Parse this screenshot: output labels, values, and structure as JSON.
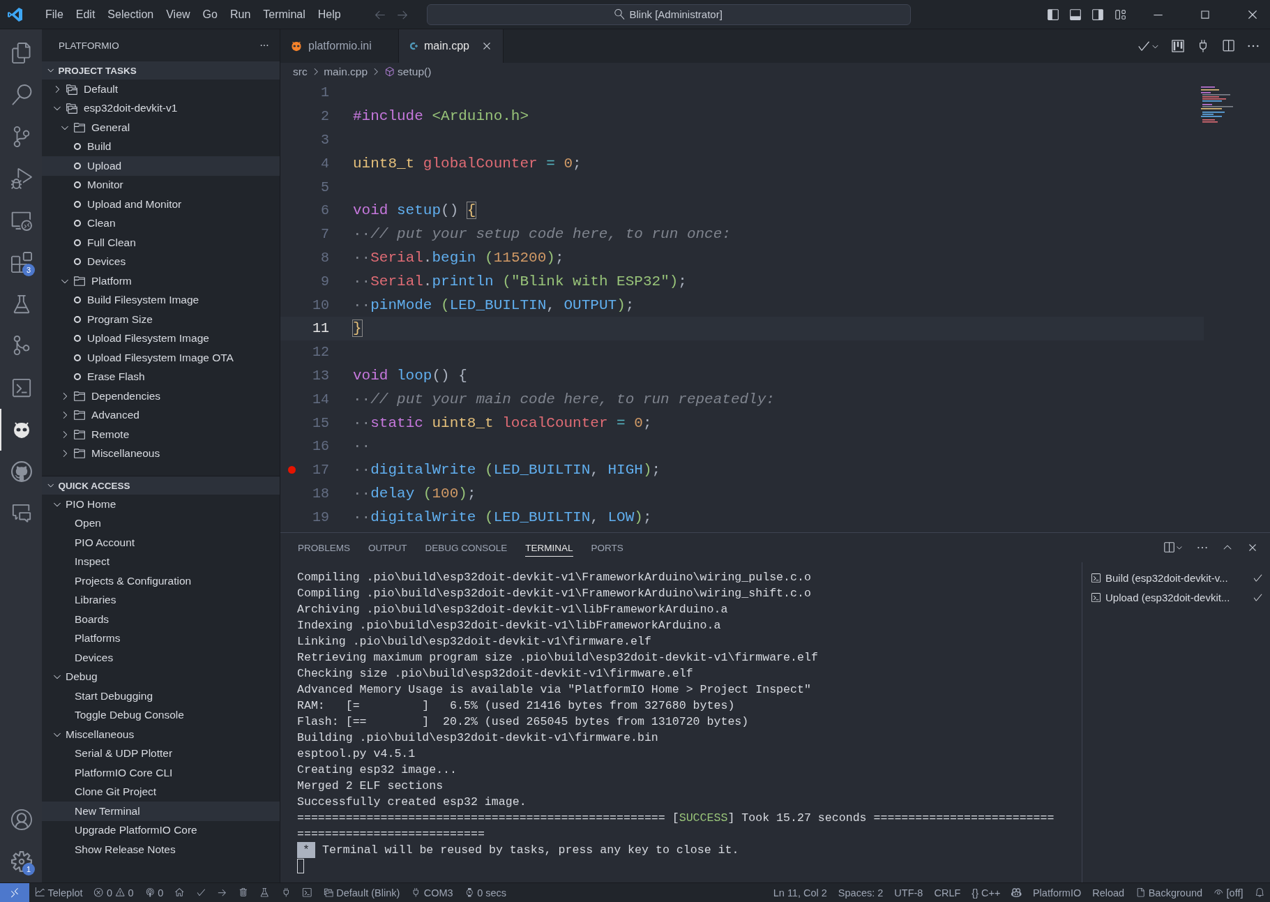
{
  "title_bar": {
    "menu": [
      "File",
      "Edit",
      "Selection",
      "View",
      "Go",
      "Run",
      "Terminal",
      "Help"
    ],
    "search": "Blink [Administrator]"
  },
  "activity_bar": {
    "items": [
      {
        "selected": false
      },
      {
        "selected": false
      },
      {
        "selected": false
      },
      {
        "selected": false
      },
      {
        "selected": false
      },
      {
        "selected": false,
        "badge": "3"
      },
      {
        "selected": false
      },
      {
        "selected": false
      },
      {
        "selected": false
      },
      {
        "selected": true
      },
      {
        "selected": false
      },
      {
        "selected": false
      }
    ],
    "bottom": [
      {
        "selected": false
      },
      {
        "selected": false,
        "badge": "1"
      }
    ]
  },
  "sidebar": {
    "title": "PLATFORMIO",
    "more": "···",
    "sections": [
      {
        "title": "PROJECT TASKS",
        "expanded": true,
        "items": [
          {
            "label": "Default",
            "kind": "env",
            "expanded": false,
            "selected": false
          },
          {
            "label": "esp32doit-devkit-v1",
            "kind": "env",
            "expanded": true,
            "selected": false,
            "children": [
              {
                "label": "General",
                "kind": "folder",
                "expanded": true,
                "selected": false,
                "children": [
                  {
                    "label": "Build",
                    "kind": "task",
                    "selected": false
                  },
                  {
                    "label": "Upload",
                    "kind": "task",
                    "selected": true
                  },
                  {
                    "label": "Monitor",
                    "kind": "task",
                    "selected": false
                  },
                  {
                    "label": "Upload and Monitor",
                    "kind": "task",
                    "selected": false
                  },
                  {
                    "label": "Clean",
                    "kind": "task",
                    "selected": false
                  },
                  {
                    "label": "Full Clean",
                    "kind": "task",
                    "selected": false
                  },
                  {
                    "label": "Devices",
                    "kind": "task",
                    "selected": false
                  }
                ]
              },
              {
                "label": "Platform",
                "kind": "folder",
                "expanded": true,
                "selected": false,
                "children": [
                  {
                    "label": "Build Filesystem Image",
                    "kind": "task",
                    "selected": false
                  },
                  {
                    "label": "Program Size",
                    "kind": "task",
                    "selected": false
                  },
                  {
                    "label": "Upload Filesystem Image",
                    "kind": "task",
                    "selected": false
                  },
                  {
                    "label": "Upload Filesystem Image OTA",
                    "kind": "task",
                    "selected": false
                  },
                  {
                    "label": "Erase Flash",
                    "kind": "task",
                    "selected": false
                  }
                ]
              },
              {
                "label": "Dependencies",
                "kind": "folder",
                "expanded": false,
                "selected": false
              },
              {
                "label": "Advanced",
                "kind": "folder",
                "expanded": false,
                "selected": false
              },
              {
                "label": "Remote",
                "kind": "folder",
                "expanded": false,
                "selected": false
              },
              {
                "label": "Miscellaneous",
                "kind": "folder",
                "expanded": false,
                "selected": false
              }
            ]
          }
        ]
      },
      {
        "title": "QUICK ACCESS",
        "expanded": true,
        "items": [
          {
            "label": "PIO Home",
            "kind": "group",
            "expanded": true,
            "selected": false,
            "children": [
              {
                "label": "Open",
                "kind": "action",
                "selected": false
              },
              {
                "label": "PIO Account",
                "kind": "action",
                "selected": false
              },
              {
                "label": "Inspect",
                "kind": "action",
                "selected": false
              },
              {
                "label": "Projects & Configuration",
                "kind": "action",
                "selected": false
              },
              {
                "label": "Libraries",
                "kind": "action",
                "selected": false
              },
              {
                "label": "Boards",
                "kind": "action",
                "selected": false
              },
              {
                "label": "Platforms",
                "kind": "action",
                "selected": false
              },
              {
                "label": "Devices",
                "kind": "action",
                "selected": false
              }
            ]
          },
          {
            "label": "Debug",
            "kind": "group",
            "expanded": true,
            "selected": false,
            "children": [
              {
                "label": "Start Debugging",
                "kind": "action",
                "selected": false
              },
              {
                "label": "Toggle Debug Console",
                "kind": "action",
                "selected": false
              }
            ]
          },
          {
            "label": "Miscellaneous",
            "kind": "group",
            "expanded": true,
            "selected": false,
            "children": [
              {
                "label": "Serial & UDP Plotter",
                "kind": "action",
                "selected": false
              },
              {
                "label": "PlatformIO Core CLI",
                "kind": "action",
                "selected": false
              },
              {
                "label": "Clone Git Project",
                "kind": "action",
                "selected": false
              },
              {
                "label": "New Terminal",
                "kind": "action",
                "selected": true
              },
              {
                "label": "Upgrade PlatformIO Core",
                "kind": "action",
                "selected": false
              },
              {
                "label": "Show Release Notes",
                "kind": "action",
                "selected": false
              }
            ]
          }
        ]
      }
    ]
  },
  "editor": {
    "tabs": [
      {
        "label": "platformio.ini",
        "kind": "ini",
        "selected": false
      },
      {
        "label": "main.cpp",
        "kind": "cpp",
        "selected": true
      }
    ],
    "breadcrumb": [
      "src",
      "main.cpp",
      "setup()"
    ],
    "lines": [
      {
        "number": "1",
        "breakpoint": false,
        "current": false
      },
      {
        "number": "2",
        "breakpoint": false,
        "current": false,
        "tokens": [
          {
            "text": "#include ",
            "kind": "keyword"
          },
          {
            "text": "<Arduino.h>",
            "kind": "string"
          }
        ]
      },
      {
        "number": "3",
        "breakpoint": false,
        "current": false
      },
      {
        "number": "4",
        "breakpoint": false,
        "current": false,
        "tokens": [
          {
            "text": "uint8_t ",
            "kind": "type"
          },
          {
            "text": "globalCounter",
            "kind": "variable"
          },
          {
            "text": " = ",
            "kind": "operator"
          },
          {
            "text": "0",
            "kind": "number"
          },
          {
            "text": ";",
            "kind": "plain"
          }
        ]
      },
      {
        "number": "5",
        "breakpoint": false,
        "current": false
      },
      {
        "number": "6",
        "breakpoint": false,
        "current": false,
        "tokens": [
          {
            "text": "void ",
            "kind": "keyword"
          },
          {
            "text": "setup",
            "kind": "function"
          },
          {
            "text": "() ",
            "kind": "plain"
          },
          {
            "text": "{",
            "kind": "matched"
          }
        ]
      },
      {
        "number": "7",
        "breakpoint": false,
        "current": false,
        "tokens": [
          {
            "text": "··",
            "kind": "whitespace"
          },
          {
            "text": "// put your setup code here, to run once:",
            "kind": "comment"
          }
        ]
      },
      {
        "number": "8",
        "breakpoint": false,
        "current": false,
        "tokens": [
          {
            "text": "··",
            "kind": "whitespace"
          },
          {
            "text": "Serial",
            "kind": "variable"
          },
          {
            "text": ".",
            "kind": "plain"
          },
          {
            "text": "begin",
            "kind": "function"
          },
          {
            "text": " (",
            "kind": "paren"
          },
          {
            "text": "115200",
            "kind": "number"
          },
          {
            "text": ")",
            "kind": "paren"
          },
          {
            "text": ";",
            "kind": "plain"
          }
        ]
      },
      {
        "number": "9",
        "breakpoint": false,
        "current": false,
        "tokens": [
          {
            "text": "··",
            "kind": "whitespace"
          },
          {
            "text": "Serial",
            "kind": "variable"
          },
          {
            "text": ".",
            "kind": "plain"
          },
          {
            "text": "println",
            "kind": "function"
          },
          {
            "text": " (",
            "kind": "paren"
          },
          {
            "text": "\"Blink with ESP32\"",
            "kind": "string"
          },
          {
            "text": ")",
            "kind": "paren"
          },
          {
            "text": ";",
            "kind": "plain"
          }
        ]
      },
      {
        "number": "10",
        "breakpoint": false,
        "current": false,
        "tokens": [
          {
            "text": "··",
            "kind": "whitespace"
          },
          {
            "text": "pinMode",
            "kind": "function"
          },
          {
            "text": " (",
            "kind": "paren"
          },
          {
            "text": "LED_BUILTIN",
            "kind": "constant"
          },
          {
            "text": ", ",
            "kind": "plain"
          },
          {
            "text": "OUTPUT",
            "kind": "constant"
          },
          {
            "text": ")",
            "kind": "paren"
          },
          {
            "text": ";",
            "kind": "plain"
          }
        ]
      },
      {
        "number": "11",
        "breakpoint": false,
        "current": true,
        "tokens": [
          {
            "text": "}",
            "kind": "matched"
          }
        ]
      },
      {
        "number": "12",
        "breakpoint": false,
        "current": false
      },
      {
        "number": "13",
        "breakpoint": false,
        "current": false,
        "tokens": [
          {
            "text": "void ",
            "kind": "keyword"
          },
          {
            "text": "loop",
            "kind": "function"
          },
          {
            "text": "() {",
            "kind": "plain"
          }
        ]
      },
      {
        "number": "14",
        "breakpoint": false,
        "current": false,
        "tokens": [
          {
            "text": "··",
            "kind": "whitespace"
          },
          {
            "text": "// put your main code here, to run repeatedly:",
            "kind": "comment"
          }
        ]
      },
      {
        "number": "15",
        "breakpoint": false,
        "current": false,
        "tokens": [
          {
            "text": "··",
            "kind": "whitespace"
          },
          {
            "text": "static ",
            "kind": "keyword"
          },
          {
            "text": "uint8_t ",
            "kind": "type"
          },
          {
            "text": "localCounter",
            "kind": "variable"
          },
          {
            "text": " = ",
            "kind": "operator"
          },
          {
            "text": "0",
            "kind": "number"
          },
          {
            "text": ";",
            "kind": "plain"
          }
        ]
      },
      {
        "number": "16",
        "breakpoint": false,
        "current": false,
        "tokens": [
          {
            "text": "··",
            "kind": "whitespace"
          }
        ]
      },
      {
        "number": "17",
        "breakpoint": true,
        "current": false,
        "tokens": [
          {
            "text": "··",
            "kind": "whitespace"
          },
          {
            "text": "digitalWrite",
            "kind": "function"
          },
          {
            "text": " (",
            "kind": "paren"
          },
          {
            "text": "LED_BUILTIN",
            "kind": "constant"
          },
          {
            "text": ", ",
            "kind": "plain"
          },
          {
            "text": "HIGH",
            "kind": "constant"
          },
          {
            "text": ")",
            "kind": "paren"
          },
          {
            "text": ";",
            "kind": "plain"
          }
        ]
      },
      {
        "number": "18",
        "breakpoint": false,
        "current": false,
        "tokens": [
          {
            "text": "··",
            "kind": "whitespace"
          },
          {
            "text": "delay",
            "kind": "function"
          },
          {
            "text": " (",
            "kind": "paren"
          },
          {
            "text": "100",
            "kind": "number"
          },
          {
            "text": ")",
            "kind": "paren"
          },
          {
            "text": ";",
            "kind": "plain"
          }
        ]
      },
      {
        "number": "19",
        "breakpoint": false,
        "current": false,
        "tokens": [
          {
            "text": "··",
            "kind": "whitespace"
          },
          {
            "text": "digitalWrite",
            "kind": "function"
          },
          {
            "text": " (",
            "kind": "paren"
          },
          {
            "text": "LED_BUILTIN",
            "kind": "constant"
          },
          {
            "text": ", ",
            "kind": "plain"
          },
          {
            "text": "LOW",
            "kind": "constant"
          },
          {
            "text": ")",
            "kind": "paren"
          },
          {
            "text": ";",
            "kind": "plain"
          }
        ]
      }
    ]
  },
  "panel": {
    "tabs": [
      {
        "label": "PROBLEMS",
        "selected": false
      },
      {
        "label": "OUTPUT",
        "selected": false
      },
      {
        "label": "DEBUG CONSOLE",
        "selected": false
      },
      {
        "label": "TERMINAL",
        "selected": true
      },
      {
        "label": "PORTS",
        "selected": false
      }
    ],
    "terminal_lines": [
      {
        "segments": [
          {
            "text": "Compiling .pio\\build\\esp32doit-devkit-v1\\FrameworkArduino\\wiring_pulse.c.o",
            "kind": "plain"
          }
        ]
      },
      {
        "segments": [
          {
            "text": "Compiling .pio\\build\\esp32doit-devkit-v1\\FrameworkArduino\\wiring_shift.c.o",
            "kind": "plain"
          }
        ]
      },
      {
        "segments": [
          {
            "text": "Archiving .pio\\build\\esp32doit-devkit-v1\\libFrameworkArduino.a",
            "kind": "plain"
          }
        ]
      },
      {
        "segments": [
          {
            "text": "Indexing .pio\\build\\esp32doit-devkit-v1\\libFrameworkArduino.a",
            "kind": "plain"
          }
        ]
      },
      {
        "segments": [
          {
            "text": "Linking .pio\\build\\esp32doit-devkit-v1\\firmware.elf",
            "kind": "plain"
          }
        ]
      },
      {
        "segments": [
          {
            "text": "Retrieving maximum program size .pio\\build\\esp32doit-devkit-v1\\firmware.elf",
            "kind": "plain"
          }
        ]
      },
      {
        "segments": [
          {
            "text": "Checking size .pio\\build\\esp32doit-devkit-v1\\firmware.elf",
            "kind": "plain"
          }
        ]
      },
      {
        "segments": [
          {
            "text": "Advanced Memory Usage is available via \"PlatformIO Home > Project Inspect\"",
            "kind": "plain"
          }
        ]
      },
      {
        "segments": [
          {
            "text": "RAM:   [=         ]   6.5% (used 21416 bytes from 327680 bytes)",
            "kind": "plain"
          }
        ]
      },
      {
        "segments": [
          {
            "text": "Flash: [==        ]  20.2% (used 265045 bytes from 1310720 bytes)",
            "kind": "plain"
          }
        ]
      },
      {
        "segments": [
          {
            "text": "Building .pio\\build\\esp32doit-devkit-v1\\firmware.bin",
            "kind": "plain"
          }
        ]
      },
      {
        "segments": [
          {
            "text": "esptool.py v4.5.1",
            "kind": "plain"
          }
        ]
      },
      {
        "segments": [
          {
            "text": "Creating esp32 image...",
            "kind": "plain"
          }
        ]
      },
      {
        "segments": [
          {
            "text": "Merged 2 ELF sections",
            "kind": "plain"
          }
        ]
      },
      {
        "segments": [
          {
            "text": "Successfully created esp32 image.",
            "kind": "plain"
          }
        ]
      },
      {
        "segments": [
          {
            "text": "===================================================== [",
            "kind": "plain"
          },
          {
            "text": "SUCCESS",
            "kind": "success"
          },
          {
            "text": "] Took 15.27 seconds ==========================",
            "kind": "plain"
          }
        ]
      },
      {
        "segments": [
          {
            "text": "===========================",
            "kind": "plain"
          }
        ]
      }
    ],
    "notice": {
      "badge": "*",
      "text": "Terminal will be reused by tasks, press any key to close it."
    },
    "sessions": [
      {
        "label": "Build (esp32doit-devkit-v...",
        "done": true
      },
      {
        "label": "Upload (esp32doit-devkit...",
        "done": true
      }
    ]
  },
  "status_bar": {
    "teleplot": "Teleplot",
    "errors": "0",
    "warnings": "0",
    "ports": "0",
    "env": "Default (Blink)",
    "port": "COM3",
    "timer": "0 secs",
    "cursor": "Ln 11, Col 2",
    "spaces": "Spaces: 2",
    "encoding": "UTF-8",
    "eol": "CRLF",
    "language": "{} C++",
    "platformio": "PlatformIO",
    "reload": "Reload",
    "background": "Background",
    "off": "[off]"
  }
}
